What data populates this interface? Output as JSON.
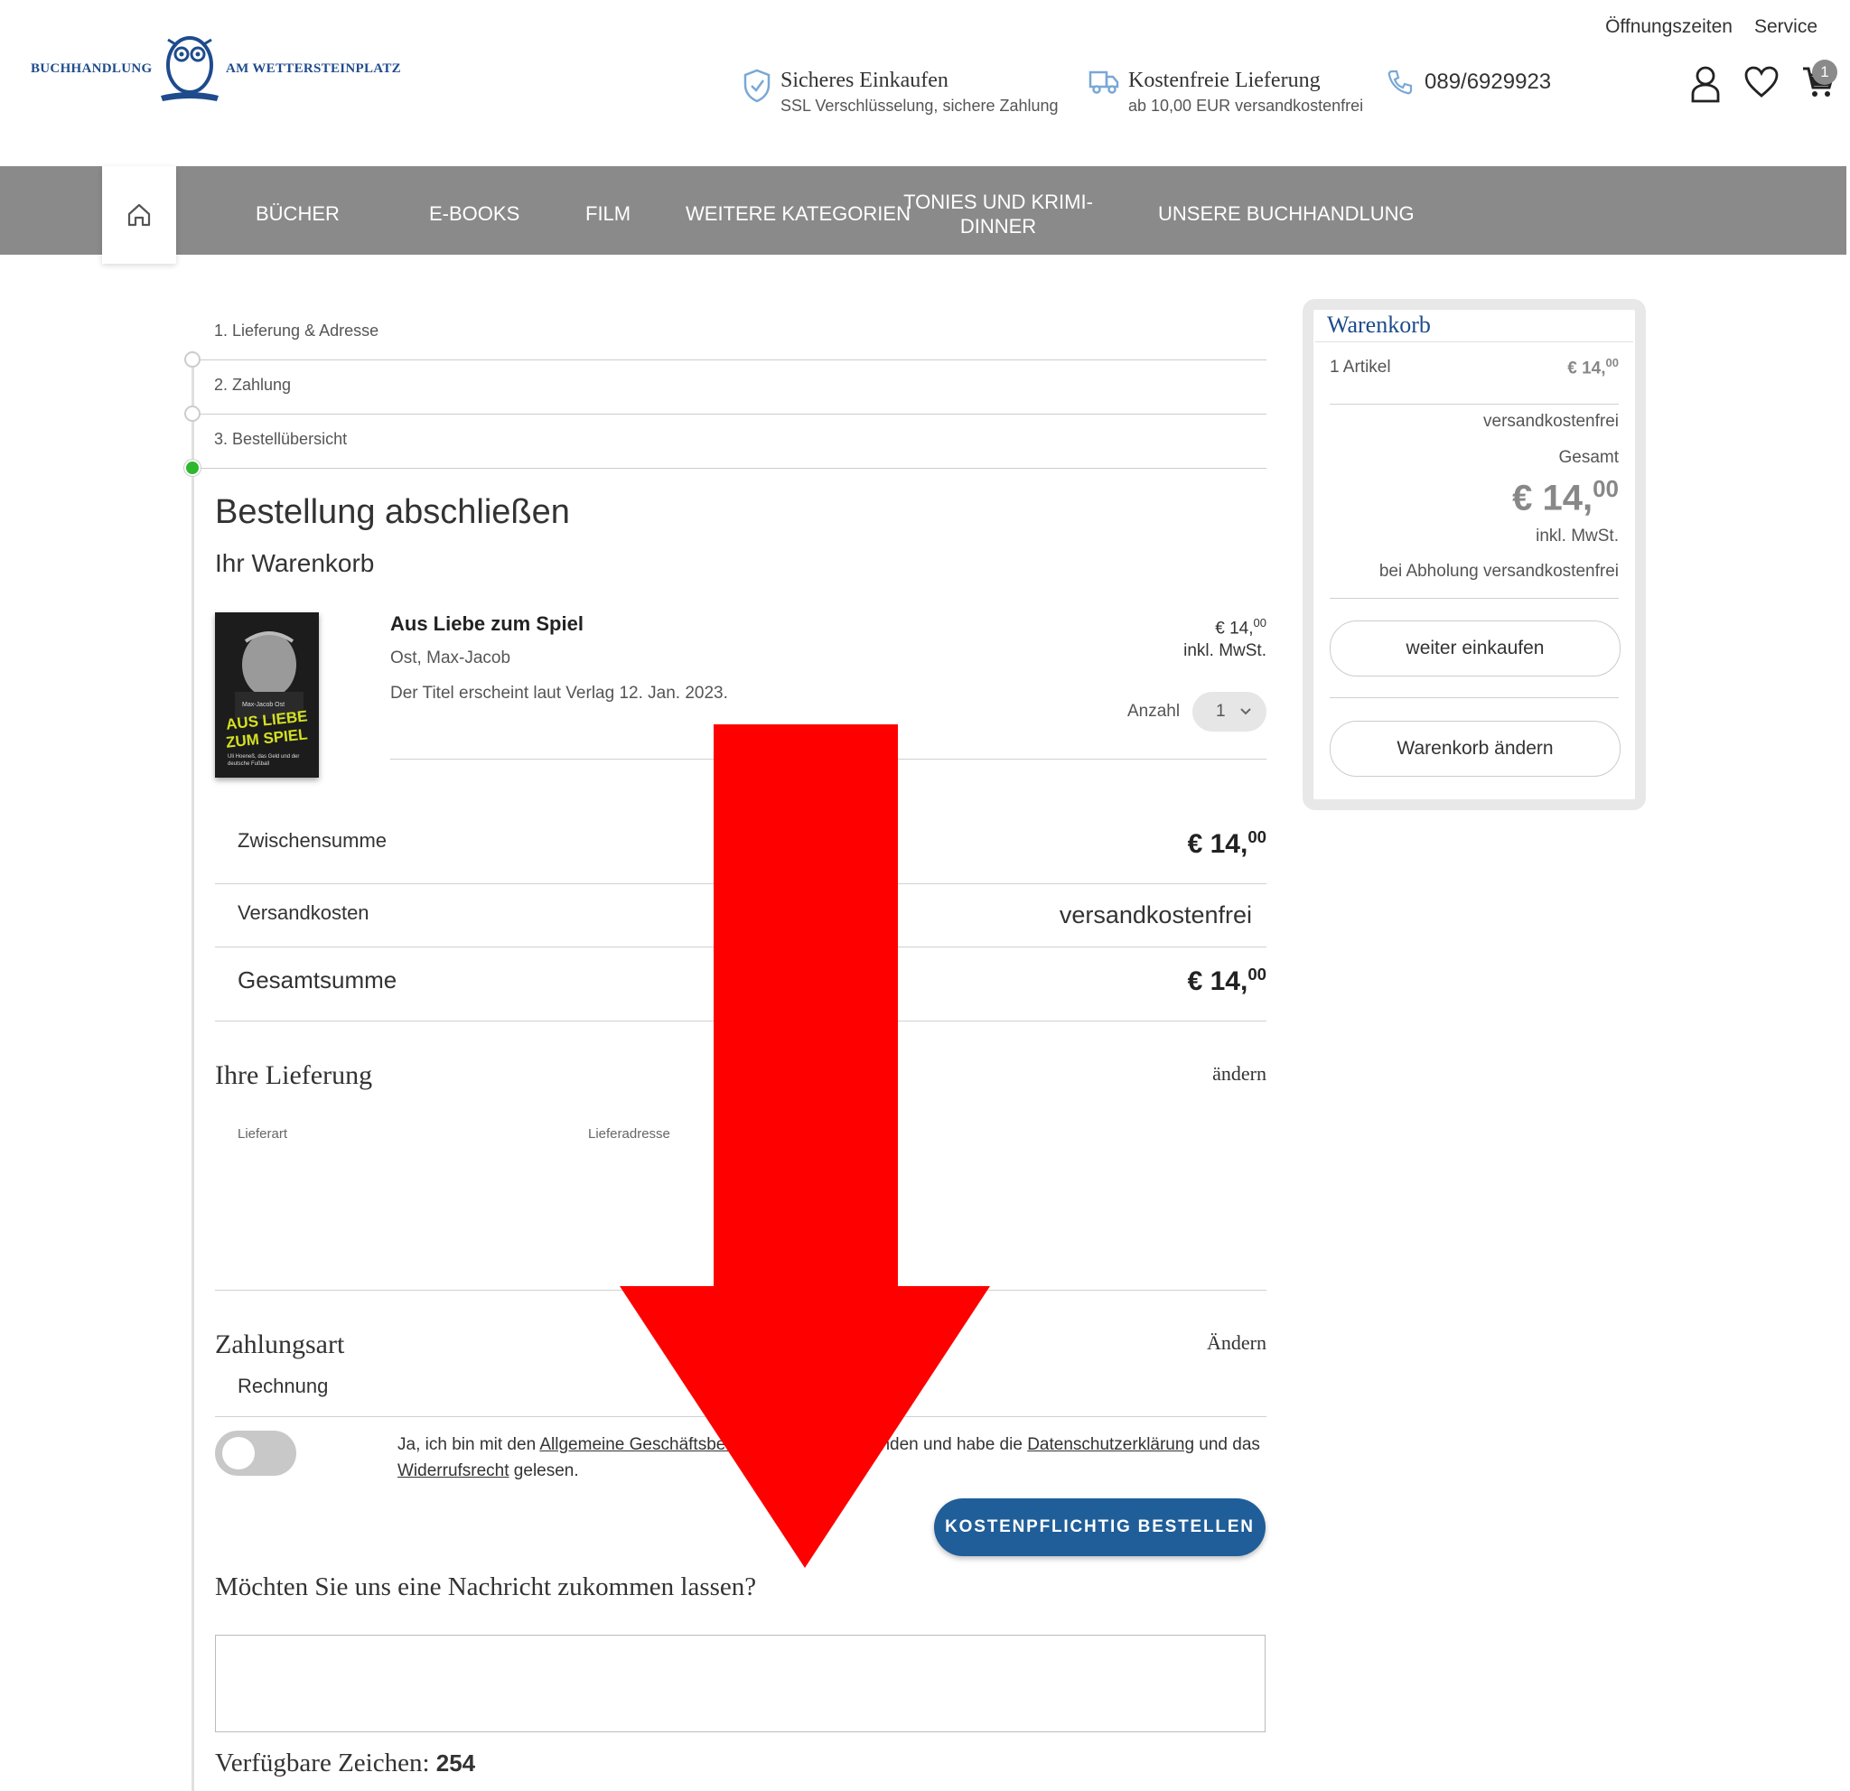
{
  "header": {
    "top_links": [
      "Öffnungszeiten",
      "Service"
    ],
    "logo_left": "BUCHHANDLUNG",
    "logo_right": "AM WETTERSTEINPLATZ",
    "trust": [
      {
        "title": "Sicheres Einkaufen",
        "subtitle": "SSL Verschlüsselung, sichere Zahlung",
        "icon": "shield-icon"
      },
      {
        "title": "Kostenfreie Lieferung",
        "subtitle": "ab 10,00 EUR versandkostenfrei",
        "icon": "truck-icon"
      }
    ],
    "phone": "089/6929923",
    "cart_count": "1"
  },
  "nav": {
    "items": [
      "BÜCHER",
      "E-BOOKS",
      "FILM",
      "WEITERE KATEGORIEN",
      "TONIES UND KRIMI-DINNER",
      "UNSERE BUCHHANDLUNG"
    ]
  },
  "steps": [
    "1. Lieferung & Adresse",
    "2. Zahlung",
    "3. Bestellübersicht"
  ],
  "page": {
    "title": "Bestellung abschließen",
    "subtitle": "Ihr Warenkorb"
  },
  "product": {
    "title": "Aus Liebe zum Spiel",
    "author": "Ost, Max-Jacob",
    "note": "Der Titel erscheint laut Verlag 12. Jan. 2023.",
    "price_main": "€ 14,",
    "price_cents": "00",
    "vat": "inkl. MwSt.",
    "qty_label": "Anzahl",
    "qty_value": "1",
    "cover_author": "Max-Jacob Ost",
    "cover_title_1": "AUS LIEBE",
    "cover_title_2": "ZUM SPIEL",
    "cover_sub": "Uli Hoeneß, das Geld und der deutsche Fußball"
  },
  "summary": {
    "subtotal_label": "Zwischensumme",
    "subtotal_main": "€ 14,",
    "subtotal_cents": "00",
    "shipping_label": "Versandkosten",
    "shipping_value": "versandkostenfrei",
    "total_label": "Gesamtsumme",
    "total_main": "€ 14,",
    "total_cents": "00"
  },
  "delivery": {
    "heading": "Ihre Lieferung",
    "edit": "ändern",
    "col1": "Lieferart",
    "col2": "Lieferadresse"
  },
  "payment": {
    "heading": "Zahlungsart",
    "edit": "Ändern",
    "method": "Rechnung"
  },
  "agreement": {
    "t1": "Ja, ich bin mit den ",
    "link_agb": "Allgemeine Geschäftsbedingungen",
    "t2": " einverstanden und habe die ",
    "link_privacy": "Datenschutzerklärung",
    "t3": " und das ",
    "link_withdrawal": "Widerrufsrecht",
    "t4": " gelesen."
  },
  "order_button": "KOSTENPFLICHTIG BESTELLEN",
  "message": {
    "heading": "Möchten Sie uns eine Nachricht zukommen lassen?",
    "value": "",
    "chars_label": "Verfügbare Zeichen:",
    "chars_count": "254"
  },
  "cart": {
    "heading": "Warenkorb",
    "items": "1 Artikel",
    "items_price_main": "€ 14,",
    "items_price_cents": "00",
    "shipping": "versandkostenfrei",
    "total_label": "Gesamt",
    "total_main": "€ 14,",
    "total_cents": "00",
    "vat": "inkl. MwSt.",
    "pickup": "bei Abholung versandkostenfrei",
    "continue_button": "weiter einkaufen",
    "edit_button": "Warenkorb ändern"
  },
  "colors": {
    "nav_bg": "#8a8a8a",
    "brand_blue": "#1e4b8c",
    "order_button": "#1f5e99",
    "active_step": "#2eb82e",
    "arrow": "#ff0000"
  }
}
